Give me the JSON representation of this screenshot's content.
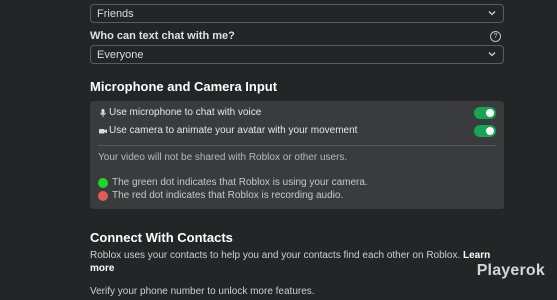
{
  "privacy": {
    "chat_select_value": "Friends",
    "text_chat_label": "Who can text chat with me?",
    "text_chat_value": "Everyone"
  },
  "mic_camera": {
    "heading": "Microphone and Camera Input",
    "mic_label": "Use microphone to chat with voice",
    "mic_enabled": true,
    "camera_label": "Use camera to animate your avatar with your movement",
    "camera_enabled": true,
    "video_note": "Your video will not be shared with Roblox or other users.",
    "green_dot_note": "The green dot indicates that Roblox is using your camera.",
    "red_dot_note": "The red dot indicates that Roblox is recording audio."
  },
  "contacts": {
    "heading": "Connect With Contacts",
    "description": "Roblox uses your contacts to help you and your contacts find each other on Roblox.",
    "learn_more": "Learn more",
    "verify_text": "Verify your phone number to unlock more features."
  },
  "watermark": "Playerok",
  "colors": {
    "background": "#232527",
    "panel": "#393b3d",
    "toggle_on": "#17a455",
    "green_dot": "#1ed623",
    "red_dot": "#e05c5c"
  },
  "icons": {
    "dropdown": "chevron-down-icon",
    "help": "help-icon",
    "microphone": "microphone-icon",
    "camera": "camera-icon"
  }
}
